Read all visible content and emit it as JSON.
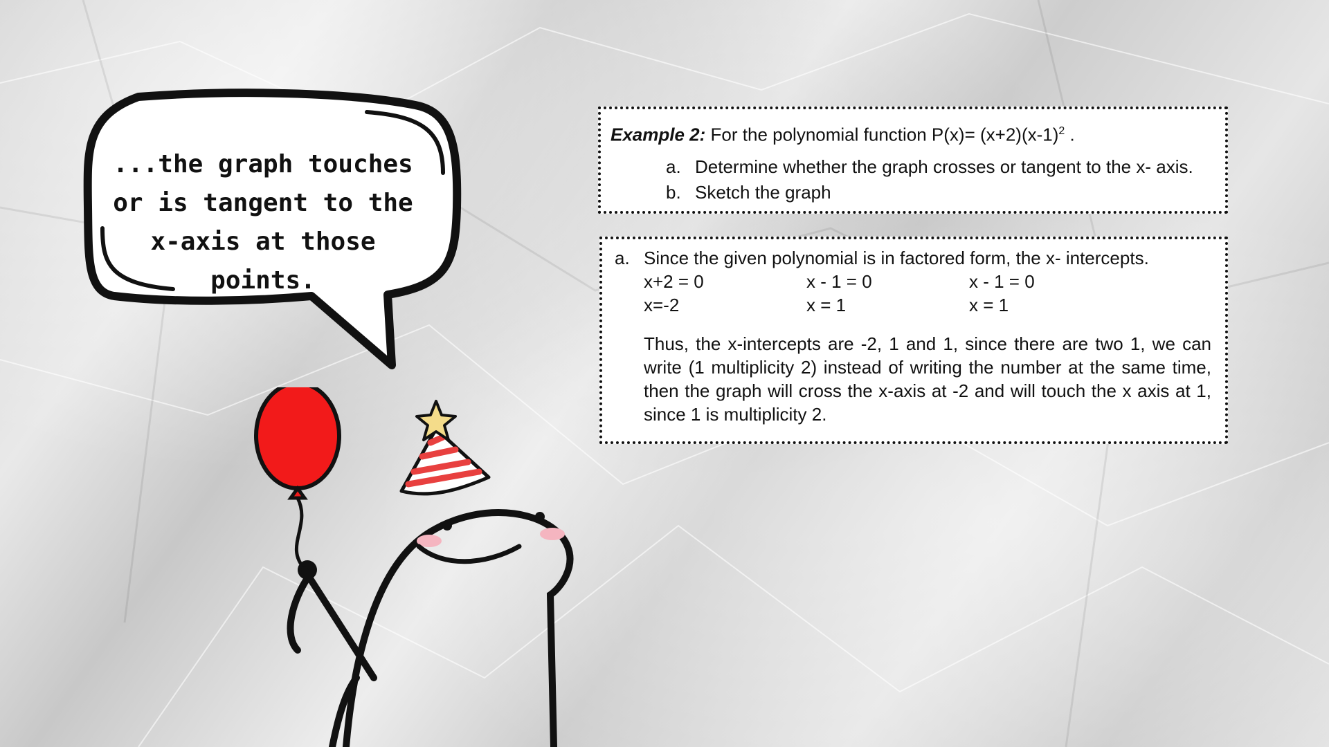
{
  "speech_bubble": {
    "text": "...the graph touches or is tangent to the x-axis at those points."
  },
  "example": {
    "title_bold": "Example 2:",
    "title_text": "For the polynomial function P(x)= (x+2)(x-1)",
    "title_sup": "2",
    "title_end": " .",
    "items": [
      {
        "marker": "a.",
        "text": "Determine whether the graph crosses or tangent to the x- axis."
      },
      {
        "marker": "b.",
        "text": "Sketch the graph"
      }
    ]
  },
  "answer": {
    "marker": "a.",
    "intro": "Since the given polynomial is in factored form, the x- intercepts.",
    "equations": [
      "x+2 = 0",
      "x - 1 = 0",
      "x - 1 = 0"
    ],
    "solutions": [
      "x=-2",
      "x = 1",
      "x = 1"
    ],
    "conclusion": "Thus, the x-intercepts are -2, 1 and 1, since there are two 1, we can write (1 multiplicity 2) instead of writing the number at the same time, then the graph will cross the x-axis at -2 and will touch the x axis at 1, since 1 is multiplicity 2."
  },
  "colors": {
    "balloon": "#f21a1a",
    "hat_stripe": "#e8403f",
    "hat_star": "#f4dc8a",
    "cheek": "#f5b5c0",
    "outline": "#111111"
  }
}
